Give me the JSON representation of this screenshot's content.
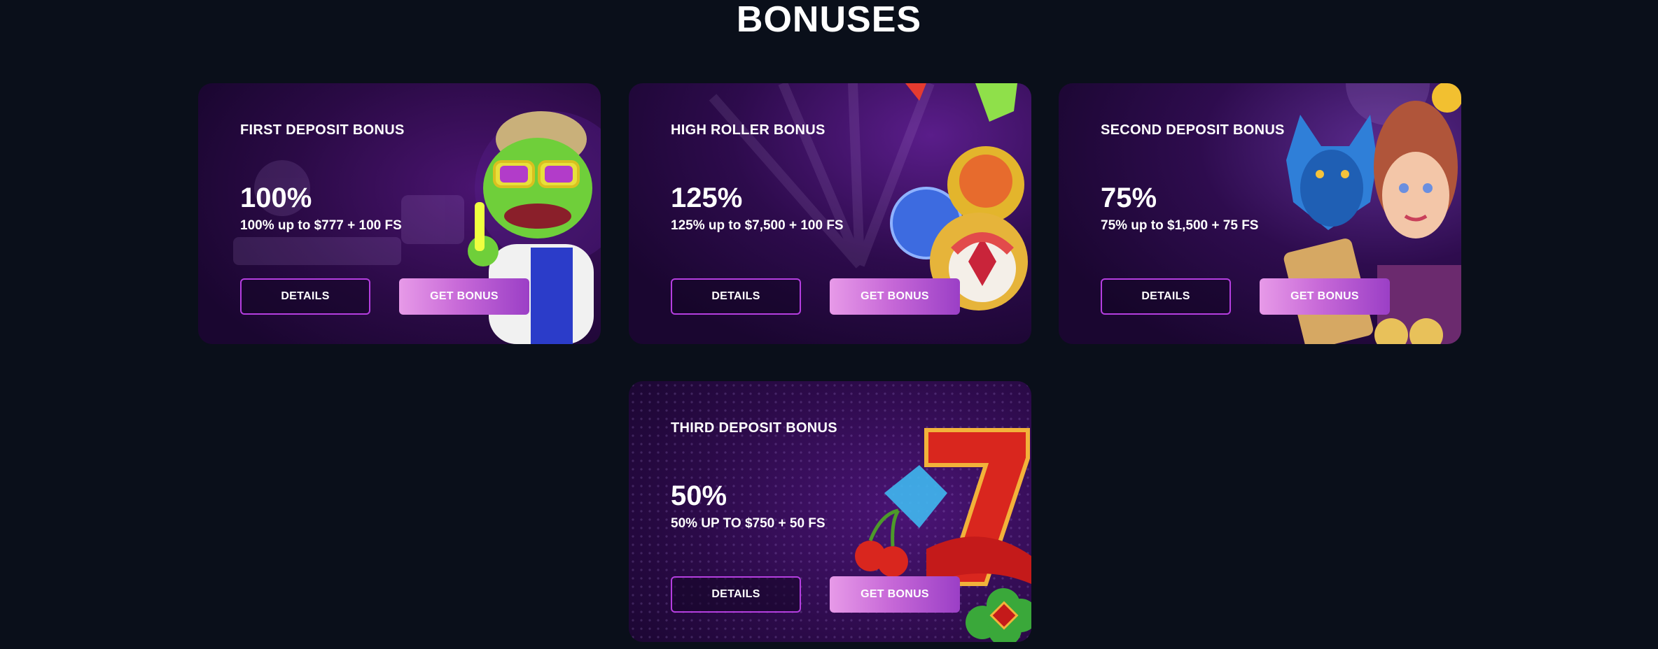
{
  "page": {
    "title": "BONUSES"
  },
  "cards": [
    {
      "title": "FIRST DEPOSIT BONUS",
      "percent": "100%",
      "description": "100% up to $777 + 100 FS",
      "details_label": "DETAILS",
      "get_label": "GET BONUS",
      "art": "frog-with-sunglasses-icon"
    },
    {
      "title": "HIGH ROLLER BONUS",
      "percent": "125%",
      "description": "125% up to $7,500 + 100 FS",
      "details_label": "DETAILS",
      "get_label": "GET BONUS",
      "art": "gems-and-candy-icon"
    },
    {
      "title": "SECOND DEPOSIT BONUS",
      "percent": "75%",
      "description": "75% up to $1,500 + 75 FS",
      "details_label": "DETAILS",
      "get_label": "GET BONUS",
      "art": "wolf-and-princess-icon"
    },
    {
      "title": "THIRD DEPOSIT BONUS",
      "percent": "50%",
      "description": "50% UP TO $750 + 50 FS",
      "details_label": "DETAILS",
      "get_label": "GET BONUS",
      "art": "lucky-seven-and-cherries-icon"
    }
  ],
  "colors": {
    "page_background": "#0a0f1a",
    "card_background": "#2a0a45",
    "details_border": "#b53ee0",
    "get_bonus_gradient_start": "#e79ae8",
    "get_bonus_gradient_end": "#9b3fc6"
  }
}
